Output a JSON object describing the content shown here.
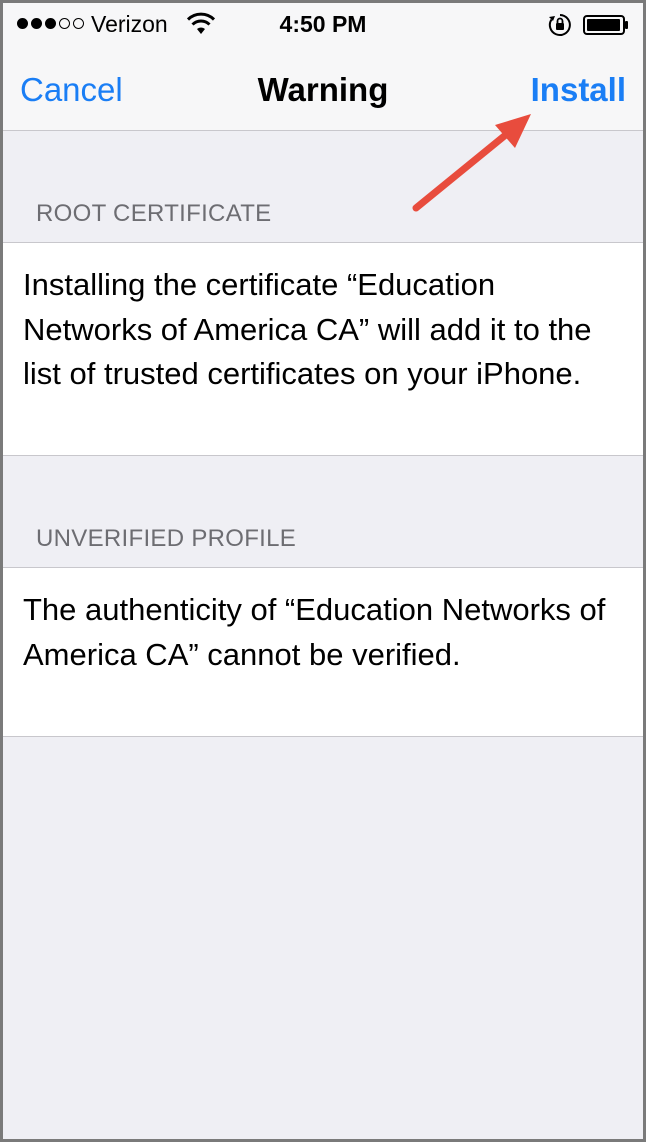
{
  "status_bar": {
    "carrier": "Verizon",
    "time": "4:50 PM",
    "signal_bars_filled": 3,
    "signal_bars_total": 5
  },
  "nav": {
    "cancel_label": "Cancel",
    "title": "Warning",
    "install_label": "Install"
  },
  "sections": [
    {
      "header": "ROOT CERTIFICATE",
      "body": "Installing the certificate “Education Networks of America CA” will add it to the list of trusted certificates on your iPhone."
    },
    {
      "header": "UNVERIFIED PROFILE",
      "body": "The authenticity of “Education Networks of America CA” cannot be verified."
    }
  ],
  "colors": {
    "accent": "#1a7ef5",
    "background": "#efeff4",
    "annotation_arrow": "#e84c3d"
  },
  "icons": [
    "signal-dots-icon",
    "wifi-icon",
    "rotation-lock-icon",
    "battery-icon",
    "annotation-arrow"
  ]
}
